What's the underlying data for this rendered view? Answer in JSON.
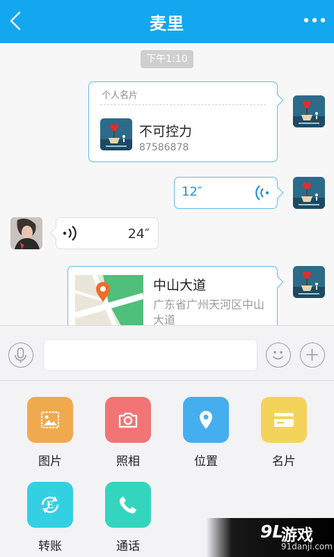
{
  "header": {
    "title": "麦里",
    "back_icon": "chevron-left-icon",
    "more_icon": "more-dots-icon",
    "color": "#12a7ee"
  },
  "chat": {
    "timestamp": "下午1:10",
    "messages": [
      {
        "type": "contact-card",
        "direction": "out",
        "header": "个人名片",
        "name": "不可控力",
        "number": "87586878"
      },
      {
        "type": "voice",
        "direction": "out",
        "duration": "12″"
      },
      {
        "type": "voice",
        "direction": "in",
        "duration": "24″"
      },
      {
        "type": "location",
        "direction": "out",
        "title": "中山大道",
        "address": "广东省广州天河区中山大道"
      }
    ]
  },
  "input_bar": {
    "message_value": "",
    "mic_icon": "mic-icon",
    "emoji_icon": "smiley-icon",
    "plus_icon": "plus-icon"
  },
  "tools": [
    {
      "label": "图片",
      "icon": "image-icon",
      "color": "#f0a94f"
    },
    {
      "label": "照相",
      "icon": "camera-icon",
      "color": "#f27474"
    },
    {
      "label": "位置",
      "icon": "location-pin-icon",
      "color": "#45aeee"
    },
    {
      "label": "名片",
      "icon": "card-icon",
      "color": "#f4d35a"
    },
    {
      "label": "转账",
      "icon": "transfer-icon",
      "color": "#33d0e3"
    },
    {
      "label": "通话",
      "icon": "phone-icon",
      "color": "#34d5bf"
    }
  ],
  "watermark": {
    "logo": "9L",
    "text": "游戏",
    "url": "91danji.com"
  }
}
